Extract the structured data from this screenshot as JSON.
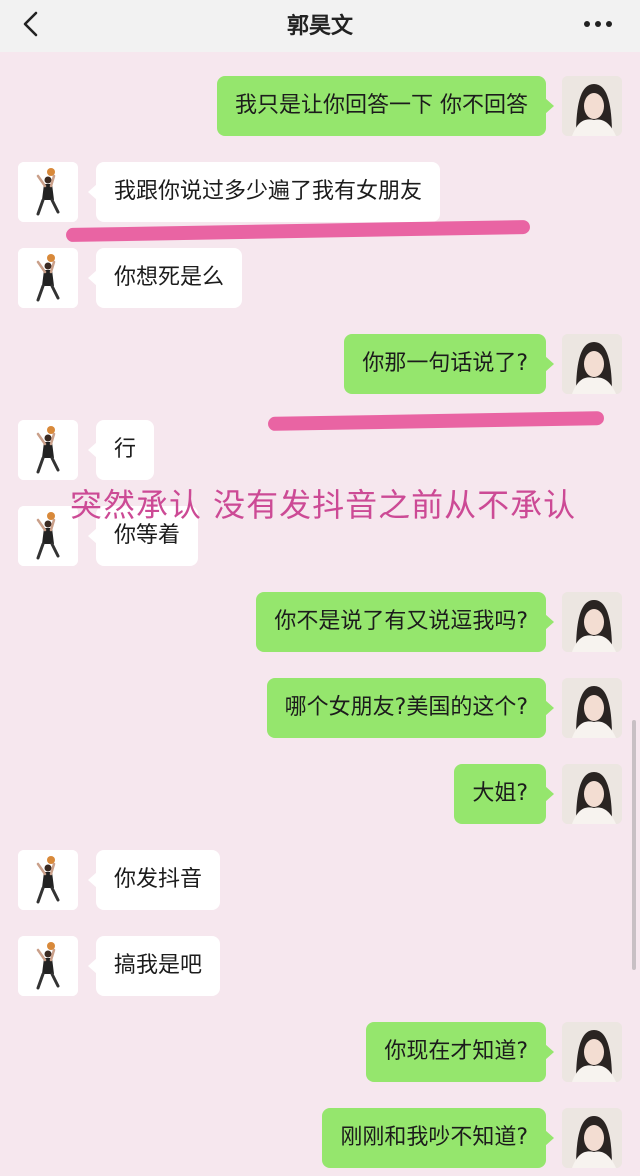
{
  "header": {
    "title": "郭昊文",
    "back_icon": "chevron-left-icon",
    "more_icon": "ellipsis-icon"
  },
  "overlay_caption": "突然承认 没有发抖音之前从不承认",
  "colors": {
    "my_bubble": "#95e66d",
    "their_bubble": "#ffffff",
    "background": "#f6e7ee",
    "highlight": "#e8559a",
    "caption": "#cc4a95"
  },
  "messages": [
    {
      "side": "me",
      "text": "我只是让你回答一下 你不回答"
    },
    {
      "side": "them",
      "text": "我跟你说过多少遍了我有女朋友"
    },
    {
      "side": "them",
      "text": "你想死是么"
    },
    {
      "side": "me",
      "text": "你那一句话说了?"
    },
    {
      "side": "them",
      "text": "行"
    },
    {
      "side": "them",
      "text": "你等着"
    },
    {
      "side": "me",
      "text": "你不是说了有又说逗我吗?"
    },
    {
      "side": "me",
      "text": "哪个女朋友?美国的这个?"
    },
    {
      "side": "me",
      "text": "大姐?"
    },
    {
      "side": "them",
      "text": "你发抖音"
    },
    {
      "side": "them",
      "text": "搞我是吧"
    },
    {
      "side": "me",
      "text": "你现在才知道?"
    },
    {
      "side": "me",
      "text": "刚刚和我吵不知道?"
    }
  ]
}
